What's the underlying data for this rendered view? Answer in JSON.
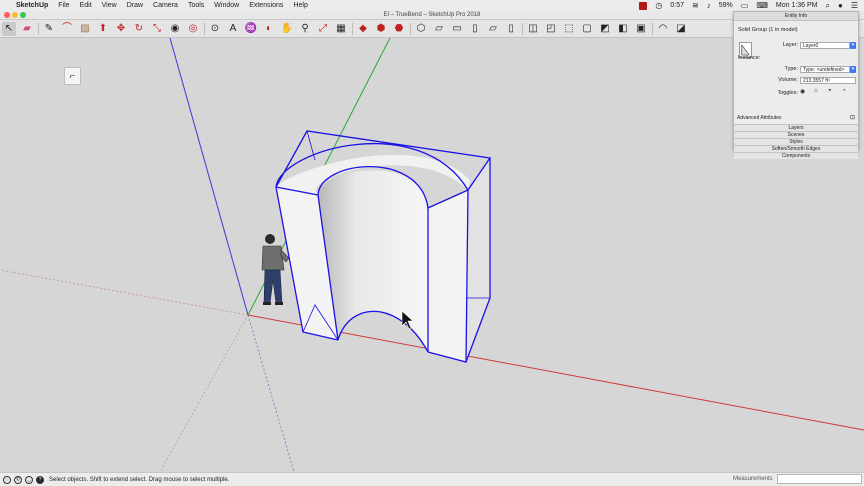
{
  "menubar": {
    "app_name": "SketchUp",
    "items": [
      "File",
      "Edit",
      "View",
      "Draw",
      "Camera",
      "Tools",
      "Window",
      "Extensions",
      "Help"
    ],
    "time_elapsed": "0:57",
    "battery": "59%",
    "clock": "Mon 1:36 PM"
  },
  "window": {
    "title": "El – TrueBend – SketchUp Pro 2018"
  },
  "toolbar": {
    "tools": [
      "select-tool-icon",
      "eraser-icon",
      "pencil-line-icon",
      "arc-icon",
      "rectangle-icon",
      "push-pull-icon",
      "move-icon",
      "rotate-icon",
      "scale-icon",
      "follow-me-icon",
      "offset-icon",
      "tape-measure-icon",
      "text-icon",
      "paint-bucket-icon",
      "orbit-icon",
      "pan-icon",
      "zoom-icon",
      "zoom-extents-icon",
      "section-plane-icon",
      "component-icon",
      "warehouse-icon",
      "extension-icon"
    ]
  },
  "entity_info": {
    "header": "Entity Info",
    "description": "Solid Group (1 in model)",
    "layer_label": "Layer:",
    "layer_value": "Layer0",
    "instance_label": "Instance:",
    "type_label": "Type:",
    "type_value": "Type: <undefined>",
    "volume_label": "Volume:",
    "volume_value": "213.3557 ft³",
    "toggles_label": "Toggles:",
    "advanced_label": "Advanced Attributes",
    "sections": [
      "Layers",
      "Scenes",
      "Styles",
      "Soften/Smooth Edges",
      "Components"
    ]
  },
  "statusbar": {
    "hint": "Select objects. Shift to extend select. Drag mouse to select multiple.",
    "measurements_label": "Measurements",
    "measurements_value": ""
  },
  "colors": {
    "selection_blue": "#1a12e6",
    "axis_red": "#d03a3a",
    "axis_green": "#2ea82e",
    "axis_blue": "#3b3bd0",
    "viewport_bg": "#d6d6d6"
  }
}
